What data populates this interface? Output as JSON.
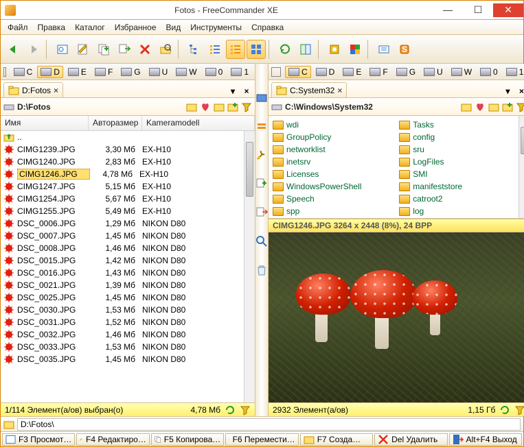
{
  "window": {
    "title": "Fotos - FreeCommander XE"
  },
  "menu": [
    "Файл",
    "Правка",
    "Каталог",
    "Избранное",
    "Вид",
    "Инструменты",
    "Справка"
  ],
  "drives": [
    "C",
    "D",
    "E",
    "F",
    "G",
    "U",
    "W",
    "0",
    "1"
  ],
  "left": {
    "active_drive": 1,
    "tab": "D:Fotos",
    "path": "D:\\Fotos",
    "cols": {
      "name": "Имя",
      "size": "Авторазмер",
      "cam": "Kameramodell"
    },
    "updir": "..",
    "files": [
      {
        "n": "CIMG1239.JPG",
        "s": "3,30 Мб",
        "c": "EX-H10"
      },
      {
        "n": "CIMG1240.JPG",
        "s": "2,83 Мб",
        "c": "EX-H10"
      },
      {
        "n": "CIMG1246.JPG",
        "s": "4,78 Мб",
        "c": "EX-H10",
        "sel": true
      },
      {
        "n": "CIMG1247.JPG",
        "s": "5,15 Мб",
        "c": "EX-H10"
      },
      {
        "n": "CIMG1254.JPG",
        "s": "5,67 Мб",
        "c": "EX-H10"
      },
      {
        "n": "CIMG1255.JPG",
        "s": "5,49 Мб",
        "c": "EX-H10"
      },
      {
        "n": "DSC_0006.JPG",
        "s": "1,29 Мб",
        "c": "NIKON D80"
      },
      {
        "n": "DSC_0007.JPG",
        "s": "1,45 Мб",
        "c": "NIKON D80"
      },
      {
        "n": "DSC_0008.JPG",
        "s": "1,46 Мб",
        "c": "NIKON D80"
      },
      {
        "n": "DSC_0015.JPG",
        "s": "1,42 Мб",
        "c": "NIKON D80"
      },
      {
        "n": "DSC_0016.JPG",
        "s": "1,43 Мб",
        "c": "NIKON D80"
      },
      {
        "n": "DSC_0021.JPG",
        "s": "1,39 Мб",
        "c": "NIKON D80"
      },
      {
        "n": "DSC_0025.JPG",
        "s": "1,45 Мб",
        "c": "NIKON D80"
      },
      {
        "n": "DSC_0030.JPG",
        "s": "1,53 Мб",
        "c": "NIKON D80"
      },
      {
        "n": "DSC_0031.JPG",
        "s": "1,52 Мб",
        "c": "NIKON D80"
      },
      {
        "n": "DSC_0032.JPG",
        "s": "1,46 Мб",
        "c": "NIKON D80"
      },
      {
        "n": "DSC_0033.JPG",
        "s": "1,53 Мб",
        "c": "NIKON D80"
      },
      {
        "n": "DSC_0035.JPG",
        "s": "1,45 Мб",
        "c": "NIKON D80"
      }
    ],
    "status_l": "1/114 Элемент(а/ов) выбран(о)",
    "status_r": "4,78 Мб"
  },
  "right": {
    "active_drive": 0,
    "tab": "C:System32",
    "path": "C:\\Windows\\System32",
    "folders_l": [
      "wdi",
      "GroupPolicy",
      "networklist",
      "inetsrv",
      "Licenses",
      "WindowsPowerShell",
      "Speech",
      "spp"
    ],
    "folders_r": [
      "Tasks",
      "config",
      "sru",
      "LogFiles",
      "SMI",
      "manifeststore",
      "catroot2",
      "log"
    ],
    "imghead": "CIMG1246.JPG   3264 x 2448 (8%), 24 BPP",
    "status_l": "2932 Элемент(а/ов)",
    "status_r": "1,15 Гб"
  },
  "pathline": "D:\\Fotos\\",
  "fkeys": [
    "F3 Просмот…",
    "F4 Редактиро…",
    "F5 Копирова…",
    "F6 Перемести…",
    "F7 Созда…",
    "Del Удалить",
    "Alt+F4 Выход"
  ]
}
